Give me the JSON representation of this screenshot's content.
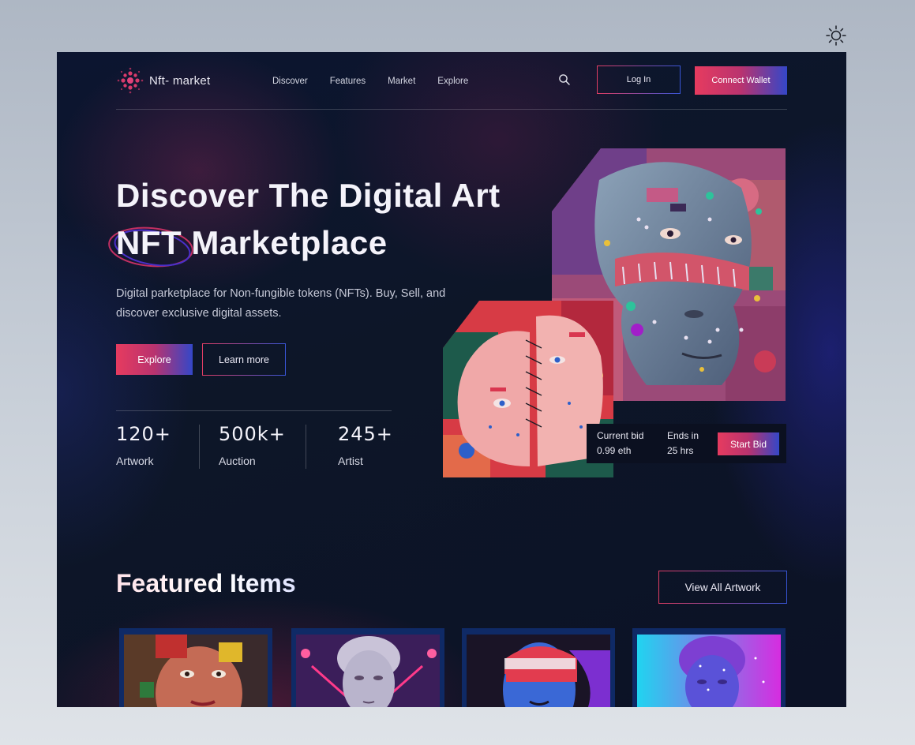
{
  "theme_toggle": {
    "icon": "sun-icon"
  },
  "nav": {
    "logo_text": "Nft- market",
    "links": [
      "Discover",
      "Features",
      "Market",
      "Explore"
    ],
    "search_icon": "search-icon",
    "login_label": "Log In",
    "connect_label": "Connect Wallet"
  },
  "hero": {
    "title_line1": "Discover The Digital Art",
    "title_highlight": "NFT",
    "title_rest": " Marketplace",
    "description": "Digital parketplace for Non-fungible tokens (NFTs). Buy, Sell, and discover exclusive digital assets.",
    "explore_label": "Explore",
    "learn_more_label": "Learn more",
    "stats": [
      {
        "value": "120+",
        "label": "Artwork"
      },
      {
        "value": "500k+",
        "label": "Auction"
      },
      {
        "value": "245+",
        "label": "Artist"
      }
    ]
  },
  "bid": {
    "current_label": "Current bid",
    "current_value": "0.99 eth",
    "ends_label": "Ends in",
    "ends_value": "25 hrs",
    "start_label": "Start Bid"
  },
  "featured": {
    "title": "Featured Items",
    "view_all_label": "View All Artwork"
  },
  "colors": {
    "accent_pink": "#e63b5f",
    "accent_blue": "#3447c8",
    "background": "#0d1628"
  }
}
